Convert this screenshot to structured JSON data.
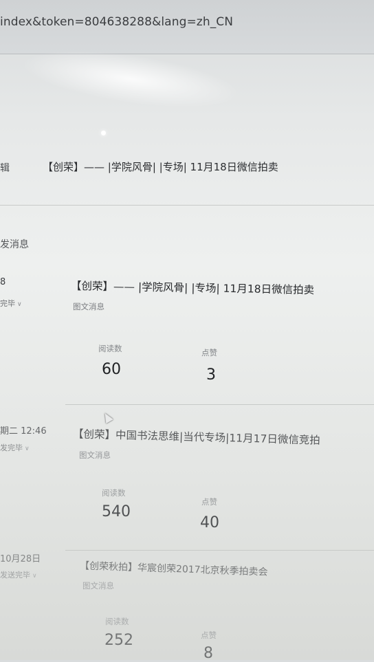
{
  "browser": {
    "url": "index&token=804638288&lang=zh_CN"
  },
  "top_row": {
    "left_text": "辑",
    "title": "【创荣】—— |学院风骨| |专场| 11月18日微信拍卖"
  },
  "section": {
    "label": "发消息"
  },
  "messages": [
    {
      "date": "8",
      "status": "完毕",
      "title": "【创荣】—— |学院风骨| |专场| 11月18日微信拍卖",
      "type": "图文消息",
      "reads_label": "阅读数",
      "reads": "60",
      "likes_label": "点赞",
      "likes": "3"
    },
    {
      "date": "期二 12:46",
      "status": "发完毕",
      "title": "【创荣】中国书法思维|当代专场|11月17日微信竞拍",
      "type": "图文消息",
      "reads_label": "阅读数",
      "reads": "540",
      "likes_label": "点赞",
      "likes": "40"
    },
    {
      "date": "10月28日",
      "status": "发送完毕",
      "title": "【创荣秋拍】华宸创荣2017北京秋季拍卖会",
      "type": "图文消息",
      "reads_label": "阅读数",
      "reads": "252",
      "likes_label": "点赞",
      "likes": "8"
    }
  ]
}
